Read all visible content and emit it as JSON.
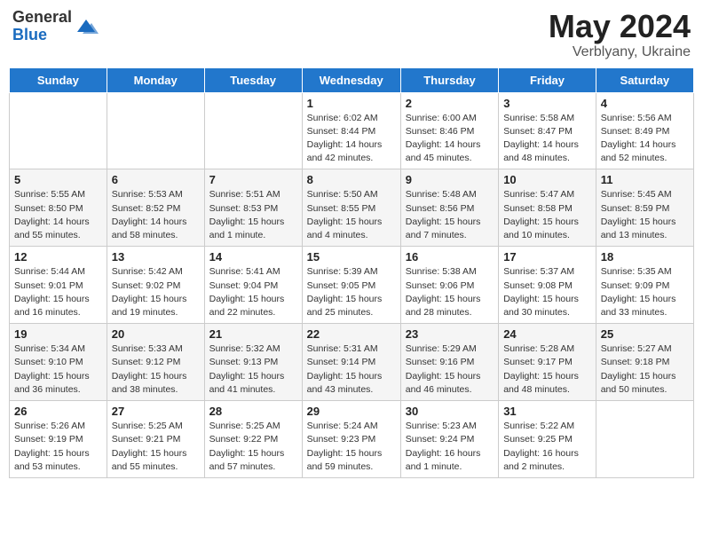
{
  "logo": {
    "general": "General",
    "blue": "Blue"
  },
  "title": {
    "month_year": "May 2024",
    "location": "Verblyany, Ukraine"
  },
  "weekdays": [
    "Sunday",
    "Monday",
    "Tuesday",
    "Wednesday",
    "Thursday",
    "Friday",
    "Saturday"
  ],
  "weeks": [
    [
      {
        "day": "",
        "info": ""
      },
      {
        "day": "",
        "info": ""
      },
      {
        "day": "",
        "info": ""
      },
      {
        "day": "1",
        "info": "Sunrise: 6:02 AM\nSunset: 8:44 PM\nDaylight: 14 hours\nand 42 minutes."
      },
      {
        "day": "2",
        "info": "Sunrise: 6:00 AM\nSunset: 8:46 PM\nDaylight: 14 hours\nand 45 minutes."
      },
      {
        "day": "3",
        "info": "Sunrise: 5:58 AM\nSunset: 8:47 PM\nDaylight: 14 hours\nand 48 minutes."
      },
      {
        "day": "4",
        "info": "Sunrise: 5:56 AM\nSunset: 8:49 PM\nDaylight: 14 hours\nand 52 minutes."
      }
    ],
    [
      {
        "day": "5",
        "info": "Sunrise: 5:55 AM\nSunset: 8:50 PM\nDaylight: 14 hours\nand 55 minutes."
      },
      {
        "day": "6",
        "info": "Sunrise: 5:53 AM\nSunset: 8:52 PM\nDaylight: 14 hours\nand 58 minutes."
      },
      {
        "day": "7",
        "info": "Sunrise: 5:51 AM\nSunset: 8:53 PM\nDaylight: 15 hours\nand 1 minute."
      },
      {
        "day": "8",
        "info": "Sunrise: 5:50 AM\nSunset: 8:55 PM\nDaylight: 15 hours\nand 4 minutes."
      },
      {
        "day": "9",
        "info": "Sunrise: 5:48 AM\nSunset: 8:56 PM\nDaylight: 15 hours\nand 7 minutes."
      },
      {
        "day": "10",
        "info": "Sunrise: 5:47 AM\nSunset: 8:58 PM\nDaylight: 15 hours\nand 10 minutes."
      },
      {
        "day": "11",
        "info": "Sunrise: 5:45 AM\nSunset: 8:59 PM\nDaylight: 15 hours\nand 13 minutes."
      }
    ],
    [
      {
        "day": "12",
        "info": "Sunrise: 5:44 AM\nSunset: 9:01 PM\nDaylight: 15 hours\nand 16 minutes."
      },
      {
        "day": "13",
        "info": "Sunrise: 5:42 AM\nSunset: 9:02 PM\nDaylight: 15 hours\nand 19 minutes."
      },
      {
        "day": "14",
        "info": "Sunrise: 5:41 AM\nSunset: 9:04 PM\nDaylight: 15 hours\nand 22 minutes."
      },
      {
        "day": "15",
        "info": "Sunrise: 5:39 AM\nSunset: 9:05 PM\nDaylight: 15 hours\nand 25 minutes."
      },
      {
        "day": "16",
        "info": "Sunrise: 5:38 AM\nSunset: 9:06 PM\nDaylight: 15 hours\nand 28 minutes."
      },
      {
        "day": "17",
        "info": "Sunrise: 5:37 AM\nSunset: 9:08 PM\nDaylight: 15 hours\nand 30 minutes."
      },
      {
        "day": "18",
        "info": "Sunrise: 5:35 AM\nSunset: 9:09 PM\nDaylight: 15 hours\nand 33 minutes."
      }
    ],
    [
      {
        "day": "19",
        "info": "Sunrise: 5:34 AM\nSunset: 9:10 PM\nDaylight: 15 hours\nand 36 minutes."
      },
      {
        "day": "20",
        "info": "Sunrise: 5:33 AM\nSunset: 9:12 PM\nDaylight: 15 hours\nand 38 minutes."
      },
      {
        "day": "21",
        "info": "Sunrise: 5:32 AM\nSunset: 9:13 PM\nDaylight: 15 hours\nand 41 minutes."
      },
      {
        "day": "22",
        "info": "Sunrise: 5:31 AM\nSunset: 9:14 PM\nDaylight: 15 hours\nand 43 minutes."
      },
      {
        "day": "23",
        "info": "Sunrise: 5:29 AM\nSunset: 9:16 PM\nDaylight: 15 hours\nand 46 minutes."
      },
      {
        "day": "24",
        "info": "Sunrise: 5:28 AM\nSunset: 9:17 PM\nDaylight: 15 hours\nand 48 minutes."
      },
      {
        "day": "25",
        "info": "Sunrise: 5:27 AM\nSunset: 9:18 PM\nDaylight: 15 hours\nand 50 minutes."
      }
    ],
    [
      {
        "day": "26",
        "info": "Sunrise: 5:26 AM\nSunset: 9:19 PM\nDaylight: 15 hours\nand 53 minutes."
      },
      {
        "day": "27",
        "info": "Sunrise: 5:25 AM\nSunset: 9:21 PM\nDaylight: 15 hours\nand 55 minutes."
      },
      {
        "day": "28",
        "info": "Sunrise: 5:25 AM\nSunset: 9:22 PM\nDaylight: 15 hours\nand 57 minutes."
      },
      {
        "day": "29",
        "info": "Sunrise: 5:24 AM\nSunset: 9:23 PM\nDaylight: 15 hours\nand 59 minutes."
      },
      {
        "day": "30",
        "info": "Sunrise: 5:23 AM\nSunset: 9:24 PM\nDaylight: 16 hours\nand 1 minute."
      },
      {
        "day": "31",
        "info": "Sunrise: 5:22 AM\nSunset: 9:25 PM\nDaylight: 16 hours\nand 2 minutes."
      },
      {
        "day": "",
        "info": ""
      }
    ]
  ]
}
